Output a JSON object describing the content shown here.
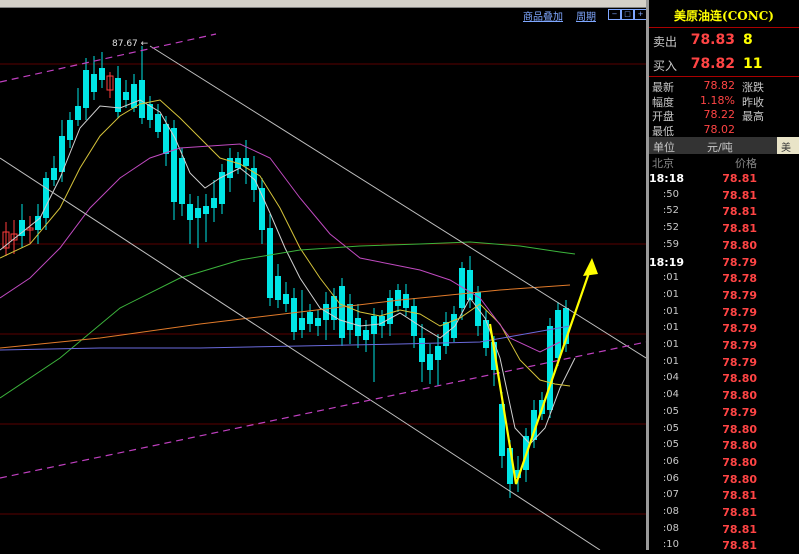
{
  "toolbar": {
    "overlay_link": "商品叠加",
    "period_link": "周期"
  },
  "chart": {
    "peak_label": "87.67",
    "colors": {
      "up_candle": "#ff3c3c",
      "down_candle": "#00e5e5",
      "ma_fast": "#d0d0d0",
      "ma_mid": "#d4c23a",
      "ma_slow": "#c04ac0",
      "ma_long": "#3cb43c",
      "ma_longer": "#e07a2a",
      "ma_longest": "#6a6adc",
      "trend_channel": "#c0c0c0",
      "dashed_trend": "#c040c0",
      "arrow": "#ffff00"
    }
  },
  "panel": {
    "title": "美原油连(CONC)",
    "orderbook": [
      {
        "label": "卖出",
        "price": "78.83",
        "volume": "8"
      },
      {
        "label": "买入",
        "price": "78.82",
        "volume": "11"
      }
    ],
    "stats": [
      {
        "label": "最新",
        "value": "78.82",
        "label2": "涨跌"
      },
      {
        "label": "幅度",
        "value": "1.18%",
        "label2": "昨收"
      },
      {
        "label": "开盘",
        "value": "78.22",
        "label2": "最高"
      },
      {
        "label": "最低",
        "value": "78.02",
        "label2": ""
      }
    ],
    "unit_label": "单位",
    "unit_value": "元/吨",
    "unit_tab_label": "美",
    "ticks_header": {
      "left": "北京",
      "right": "价格"
    },
    "ticks": [
      {
        "time": "18:18",
        "price": "78.81"
      },
      {
        "time": ":50",
        "price": "78.81"
      },
      {
        "time": ":52",
        "price": "78.81"
      },
      {
        "time": ":52",
        "price": "78.81"
      },
      {
        "time": ":59",
        "price": "78.80"
      },
      {
        "time": "18:19",
        "price": "78.79"
      },
      {
        "time": ":01",
        "price": "78.78"
      },
      {
        "time": ":01",
        "price": "78.79"
      },
      {
        "time": ":01",
        "price": "78.79"
      },
      {
        "time": ":01",
        "price": "78.79"
      },
      {
        "time": ":01",
        "price": "78.79"
      },
      {
        "time": ":01",
        "price": "78.79"
      },
      {
        "time": ":04",
        "price": "78.80"
      },
      {
        "time": ":04",
        "price": "78.80"
      },
      {
        "time": ":05",
        "price": "78.79"
      },
      {
        "time": ":05",
        "price": "78.80"
      },
      {
        "time": ":05",
        "price": "78.80"
      },
      {
        "time": ":06",
        "price": "78.80"
      },
      {
        "time": ":06",
        "price": "78.80"
      },
      {
        "time": ":07",
        "price": "78.81"
      },
      {
        "time": ":08",
        "price": "78.81"
      },
      {
        "time": ":08",
        "price": "78.81"
      },
      {
        "time": ":10",
        "price": "78.81"
      }
    ]
  }
}
